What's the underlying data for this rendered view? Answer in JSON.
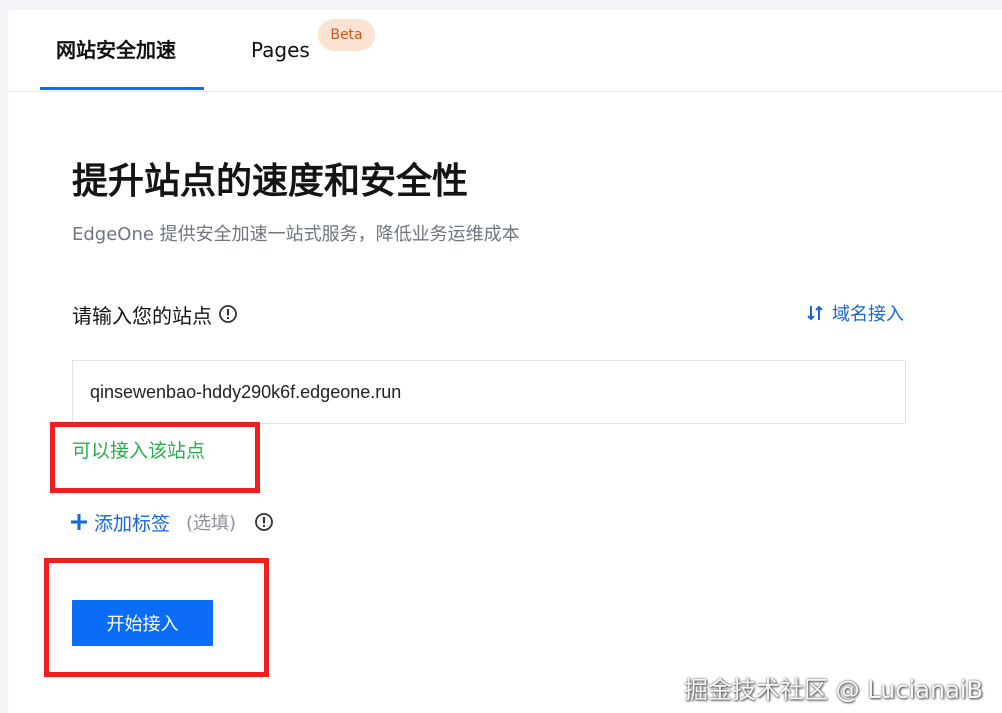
{
  "tabs": [
    {
      "label": "网站安全加速",
      "active": true
    },
    {
      "label": "Pages",
      "badge": "Beta",
      "active": false
    }
  ],
  "hero": {
    "title": "提升站点的速度和安全性",
    "subtitle": "EdgeOne 提供安全加速一站式服务，降低业务运维成本"
  },
  "site_form": {
    "label": "请输入您的站点",
    "switch_link": "域名接入",
    "input_value": "qinsewenbao-hddy290k6f.edgeone.run",
    "status": "可以接入该站点",
    "add_tag": "添加标签",
    "optional": "(选填)",
    "start_button": "开始接入"
  },
  "watermark": "掘金技术社区 @ LucianaiB",
  "colors": {
    "accent": "#0b6cf5",
    "link": "#1666dd",
    "success": "#26b04d",
    "highlight": "#f21d1d",
    "badge_bg": "#fbe3d3",
    "badge_text": "#d0561c"
  },
  "icons": {
    "info": "info-circle-icon",
    "switch": "swap-arrows-icon",
    "add": "plus-icon"
  }
}
